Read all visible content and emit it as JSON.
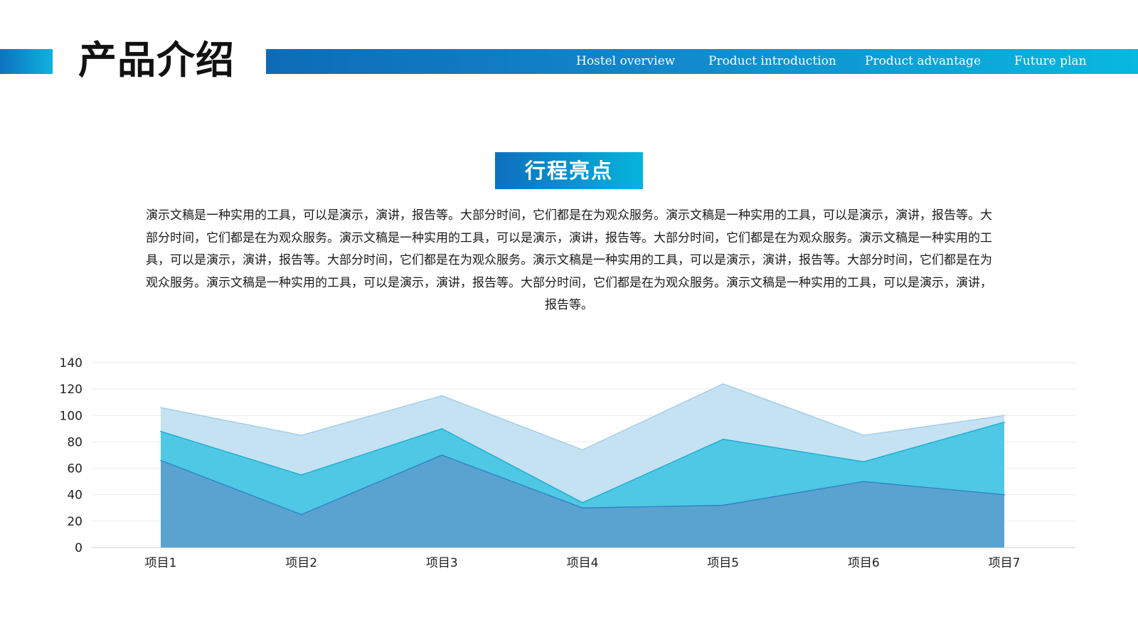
{
  "header": {
    "title": "产品介绍",
    "nav": [
      {
        "label": "Hostel overview"
      },
      {
        "label": "Product introduction"
      },
      {
        "label": "Product advantage"
      },
      {
        "label": "Future plan"
      }
    ]
  },
  "section": {
    "badge": "行程亮点",
    "paragraph": "演示文稿是一种实用的工具，可以是演示，演讲，报告等。大部分时间，它们都是在为观众服务。演示文稿是一种实用的工具，可以是演示，演讲，报告等。大部分时间，它们都是在为观众服务。演示文稿是一种实用的工具，可以是演示，演讲，报告等。大部分时间，它们都是在为观众服务。演示文稿是一种实用的工具，可以是演示，演讲，报告等。大部分时间，它们都是在为观众服务。演示文稿是一种实用的工具，可以是演示，演讲，报告等。大部分时间，它们都是在为观众服务。演示文稿是一种实用的工具，可以是演示，演讲，报告等。大部分时间，它们都是在为观众服务。演示文稿是一种实用的工具，可以是演示，演讲，报告等。"
  },
  "colors": {
    "header_gradient_start": "#0d6cb7",
    "header_gradient_end": "#08b8e0",
    "series": [
      "#5b9fcf",
      "#43c6e3",
      "#bfdff2"
    ],
    "series_stroke": [
      "#2e80c0",
      "#18a9d1",
      "#9ecbea"
    ]
  },
  "chart_data": {
    "type": "area",
    "categories": [
      "项目1",
      "项目2",
      "项目3",
      "项目4",
      "项目5",
      "项目6",
      "项目7"
    ],
    "series": [
      {
        "values": [
          66,
          25,
          70,
          30,
          32,
          50,
          40
        ]
      },
      {
        "values": [
          88,
          55,
          90,
          34,
          82,
          65,
          95
        ]
      },
      {
        "values": [
          106,
          85,
          115,
          74,
          124,
          85,
          100
        ]
      }
    ],
    "ylim": [
      0,
      140
    ],
    "yticks": [
      "0",
      "20",
      "40",
      "60",
      "80",
      "100",
      "120",
      "140"
    ],
    "grid": true,
    "legend": "none"
  }
}
